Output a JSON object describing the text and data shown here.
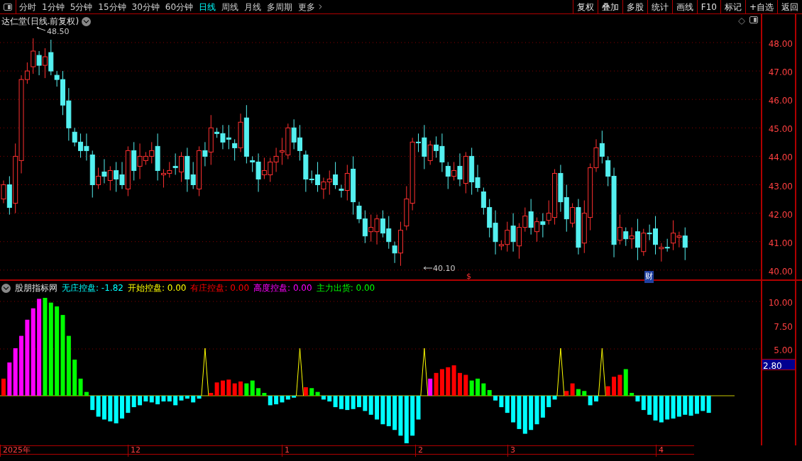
{
  "toolbar": {
    "periods": [
      {
        "label": "分时",
        "selected": false
      },
      {
        "label": "1分钟",
        "selected": false
      },
      {
        "label": "5分钟",
        "selected": false
      },
      {
        "label": "15分钟",
        "selected": false
      },
      {
        "label": "30分钟",
        "selected": false
      },
      {
        "label": "60分钟",
        "selected": false
      },
      {
        "label": "日线",
        "selected": true
      },
      {
        "label": "周线",
        "selected": false
      },
      {
        "label": "月线",
        "selected": false
      },
      {
        "label": "多周期",
        "selected": false
      },
      {
        "label": "更多",
        "selected": false
      }
    ],
    "actions": [
      "复权",
      "叠加",
      "多股",
      "统计",
      "画线",
      "F10",
      "标记",
      "+自选",
      "返回"
    ]
  },
  "price_chart": {
    "title": "达仁堂(日线.前复权)",
    "high_label": "48.50",
    "low_label": "40.10",
    "markers": [
      {
        "text": "$",
        "kind": "dividend"
      },
      {
        "text": "财",
        "kind": "report"
      }
    ],
    "y_axis": [
      "48.00",
      "47.00",
      "46.00",
      "45.00",
      "44.00",
      "43.00",
      "42.00",
      "41.00",
      "40.00"
    ]
  },
  "indicator": {
    "title": "股朋指标网",
    "readouts": [
      {
        "text": "无庄控盘: -1.82",
        "color": "#00ffff"
      },
      {
        "text": "开始控盘: 0.00",
        "color": "#ffff00"
      },
      {
        "text": "有庄控盘: 0.00",
        "color": "#ff0000"
      },
      {
        "text": "高度控盘: 0.00",
        "color": "#ff00ff"
      },
      {
        "text": "主力出货: 0.00",
        "color": "#00ff00"
      }
    ],
    "y_axis": [
      "10.00",
      "7.50",
      "5.00"
    ],
    "cursor_value": "2.80"
  },
  "time_axis": [
    "2025年",
    "12",
    "1",
    "2",
    "3",
    "4"
  ]
}
